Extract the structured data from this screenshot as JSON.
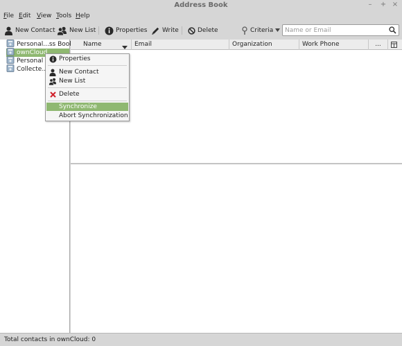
{
  "window": {
    "title": "Address Book",
    "controls": [
      "–",
      "+",
      "×"
    ]
  },
  "menubar": [
    "File",
    "Edit",
    "View",
    "Tools",
    "Help"
  ],
  "toolbar": {
    "new_contact": "New Contact",
    "new_list": "New List",
    "properties": "Properties",
    "write": "Write",
    "delete": "Delete",
    "criteria": "Criteria",
    "search_placeholder": "Name or Email"
  },
  "address_books": [
    {
      "label": "Personal...ss Book",
      "selected": false
    },
    {
      "label": "ownCloud",
      "selected": true
    },
    {
      "label": "Personal",
      "selected": false
    },
    {
      "label": "Collecte...",
      "selected": false
    }
  ],
  "columns": [
    "Name",
    "Email",
    "Organization",
    "Work Phone",
    "..."
  ],
  "context_menu": {
    "items": [
      {
        "label": "Properties",
        "icon": "info-icon"
      },
      {
        "label": "New Contact",
        "icon": "person-icon"
      },
      {
        "label": "New List",
        "icon": "people-icon"
      },
      {
        "label": "Delete",
        "icon": "red-x-icon"
      },
      {
        "label": "Synchronize",
        "icon": "",
        "highlighted": true
      },
      {
        "label": "Abort Synchronization",
        "icon": ""
      }
    ]
  },
  "status": "Total contacts in ownCloud: 0",
  "colors": {
    "selection": "#8fb871",
    "window_bg": "#d6d6d6",
    "delete_red": "#d0202a"
  }
}
